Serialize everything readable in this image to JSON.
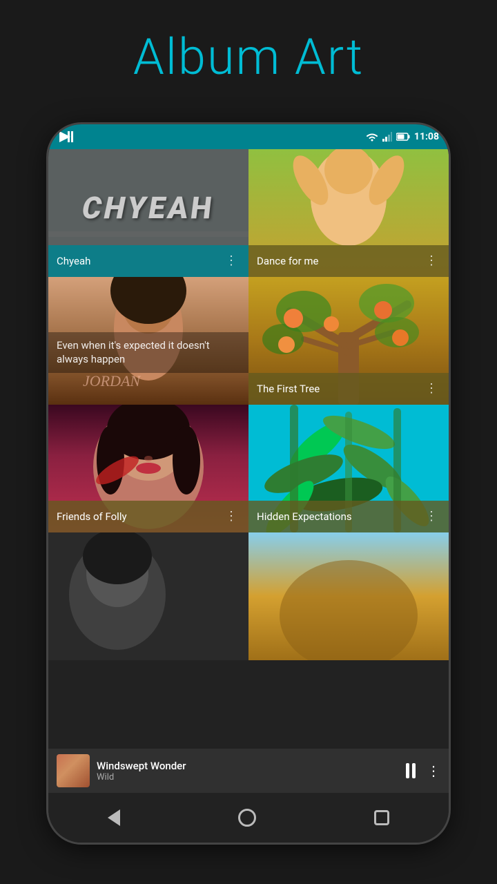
{
  "page": {
    "title": "Album Art",
    "background_color": "#1a1a1a",
    "title_color": "#00bcd4"
  },
  "statusBar": {
    "time": "11:08",
    "teal_color": "#00838f"
  },
  "albums": [
    {
      "id": "chyeah",
      "name": "Chyeah",
      "art_style": "chyeah",
      "label_color": "teal",
      "has_more": true
    },
    {
      "id": "dance",
      "name": "Dance for me",
      "art_style": "dance",
      "label_color": "olive",
      "has_more": true
    },
    {
      "id": "jordan",
      "name": "Even when it's expected it doesn't always happen",
      "art_style": "jordan",
      "label_color": "dark-overlay",
      "has_more": false,
      "text_overlay": "Even when it's expected it doesn't always happen"
    },
    {
      "id": "firsttree",
      "name": "The First Tree",
      "art_style": "firsttree",
      "label_color": "olive",
      "has_more": true
    },
    {
      "id": "folly",
      "name": "Friends of Folly",
      "art_style": "folly",
      "label_color": "olive",
      "has_more": true
    },
    {
      "id": "hidden",
      "name": "Hidden Expectations",
      "art_style": "hidden",
      "label_color": "olive",
      "has_more": true
    }
  ],
  "player": {
    "title": "Windswept Wonder",
    "subtitle": "Wild",
    "is_playing": true
  },
  "nav": {
    "back_label": "back",
    "home_label": "home",
    "recents_label": "recents"
  }
}
